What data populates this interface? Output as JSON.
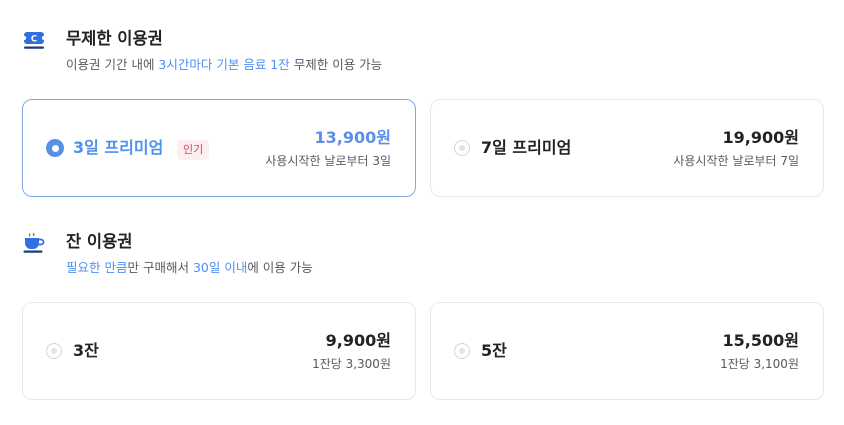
{
  "unlimited": {
    "title": "무제한 이용권",
    "subtitle_pre": "이용권 기간 내에 ",
    "subtitle_hl": "3시간마다 기본 음료 1잔",
    "subtitle_post": " 무제한 이용 가능",
    "plans": [
      {
        "name": "3일 프리미엄",
        "badge": "인기",
        "price": "13,900원",
        "note": "사용시작한 날로부터 3일",
        "selected": true
      },
      {
        "name": "7일 프리미엄",
        "price": "19,900원",
        "note": "사용시작한 날로부터 7일",
        "selected": false
      }
    ]
  },
  "cup": {
    "title": "잔 이용권",
    "subtitle_hl1": "필요한 만큼",
    "subtitle_mid": "만 구매해서 ",
    "subtitle_hl2": "30일 이내",
    "subtitle_post": "에 이용 가능",
    "plans": [
      {
        "name": "3잔",
        "price": "9,900원",
        "note": "1잔당 3,300원",
        "selected": false
      },
      {
        "name": "5잔",
        "price": "15,500원",
        "note": "1잔당 3,100원",
        "selected": false
      }
    ]
  },
  "colors": {
    "accent": "#4f8ff0",
    "badge_text": "#e0455a",
    "badge_bg": "#fdeef0"
  }
}
